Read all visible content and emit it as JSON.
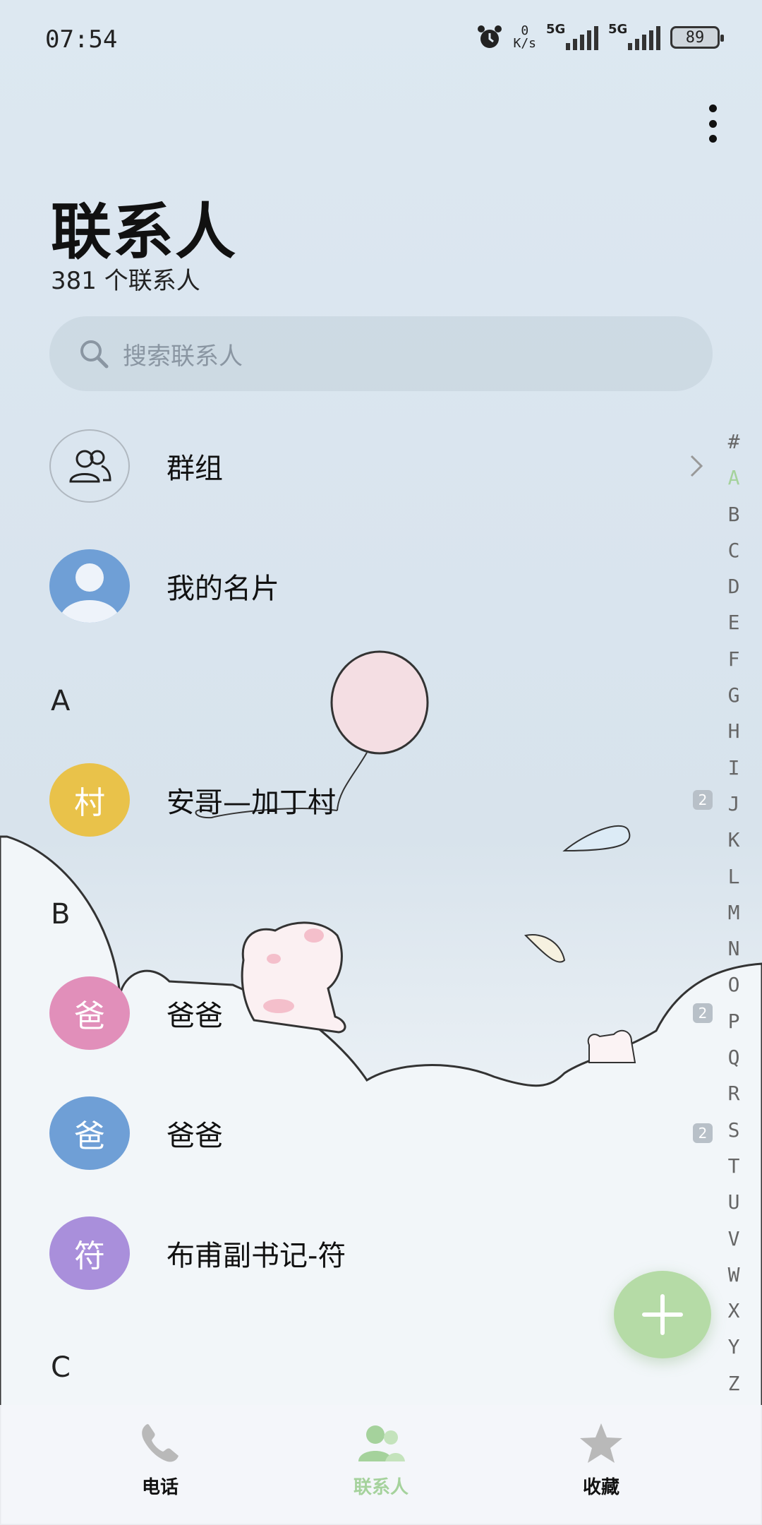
{
  "status_bar": {
    "time": "07:54",
    "net_speed_value": "0",
    "net_speed_unit": "K/s",
    "sim1_label": "5G",
    "sim2_label": "5G",
    "battery": "89"
  },
  "header": {
    "title": "联系人",
    "count": "381 个联系人"
  },
  "search": {
    "placeholder": "搜索联系人"
  },
  "groups": {
    "label": "群组"
  },
  "my_card": {
    "label": "我的名片"
  },
  "sections": [
    {
      "letter": "A"
    },
    {
      "letter": "B"
    },
    {
      "letter": "C"
    }
  ],
  "contacts": [
    {
      "avatar_text": "村",
      "name": "安哥—加丁村",
      "badge": "2",
      "color": "#e9c24a"
    },
    {
      "avatar_text": "爸",
      "name": "爸爸",
      "badge": "2",
      "color": "#e18fba"
    },
    {
      "avatar_text": "爸",
      "name": "爸爸",
      "badge": "2",
      "color": "#6f9fd6"
    },
    {
      "avatar_text": "符",
      "name": "布甫副书记-符",
      "badge": "",
      "color": "#a98fdb"
    }
  ],
  "alphabet_index": [
    "#",
    "A",
    "B",
    "C",
    "D",
    "E",
    "F",
    "G",
    "H",
    "I",
    "J",
    "K",
    "L",
    "M",
    "N",
    "O",
    "P",
    "Q",
    "R",
    "S",
    "T",
    "U",
    "V",
    "W",
    "X",
    "Y",
    "Z"
  ],
  "alphabet_active": "A",
  "bottom_nav": [
    {
      "label": "电话",
      "icon": "phone-icon"
    },
    {
      "label": "联系人",
      "icon": "contacts-icon",
      "active": true
    },
    {
      "label": "收藏",
      "icon": "star-icon"
    }
  ],
  "colors": {
    "accent_green": "#a5d29c",
    "fab": "#b5dba6",
    "my_card_avatar": "#6f9fd6"
  }
}
